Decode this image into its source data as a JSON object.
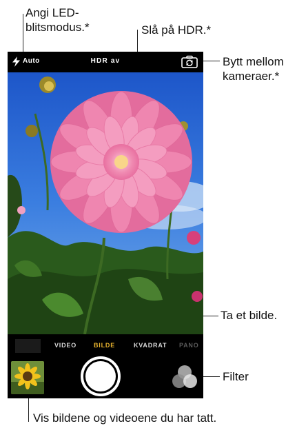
{
  "callouts": {
    "flash": [
      "Angi LED-",
      "blitsmodus.*"
    ],
    "hdr": "Slå på HDR.*",
    "switch_camera": [
      "Bytt mellom",
      "kameraer.*"
    ],
    "take_photo": "Ta et bilde.",
    "filter": "Filter",
    "view_media": "Vis bildene og videoene du har tatt."
  },
  "topbar": {
    "flash_icon": "lightning-icon",
    "flash_label": "Auto",
    "hdr_label": "HDR av",
    "switch_icon": "camera-switch-icon"
  },
  "modes": [
    "VIDEO",
    "BILDE",
    "KVADRAT",
    "PANO"
  ],
  "active_mode": "BILDE",
  "colors": {
    "active_mode": "#e6b22e",
    "sky": "#2f6ed6",
    "petals": "#f28db5",
    "foliage": "#2e5a1e"
  }
}
